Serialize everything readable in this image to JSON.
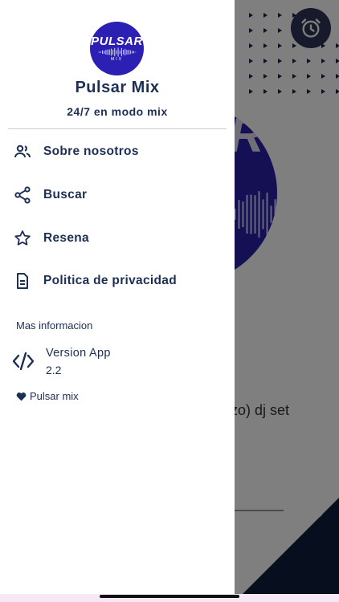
{
  "drawer": {
    "logo_text": "PULSAR",
    "logo_subtext": "MIX",
    "app_name": "Pulsar Mix",
    "tagline": "24/7 en modo mix",
    "menu": [
      {
        "label": "Sobre nosotros",
        "icon": "people-icon"
      },
      {
        "label": "Buscar",
        "icon": "share-icon"
      },
      {
        "label": "Resena",
        "icon": "star-icon"
      },
      {
        "label": "Politica de privacidad",
        "icon": "document-icon"
      }
    ],
    "more_info_header": "Mas informacion",
    "version_label": "Version App",
    "version_number": "2.2",
    "footer_label": "Pulsar mix"
  },
  "background": {
    "now_playing": "arzo) dj set",
    "logo_letter": "R"
  },
  "colors": {
    "primary_text": "#1c2f55",
    "logo_blue": "#2c1fb3",
    "scrim": "rgba(0,0,0,0.5)",
    "dark_navy": "#0f1d3a"
  }
}
